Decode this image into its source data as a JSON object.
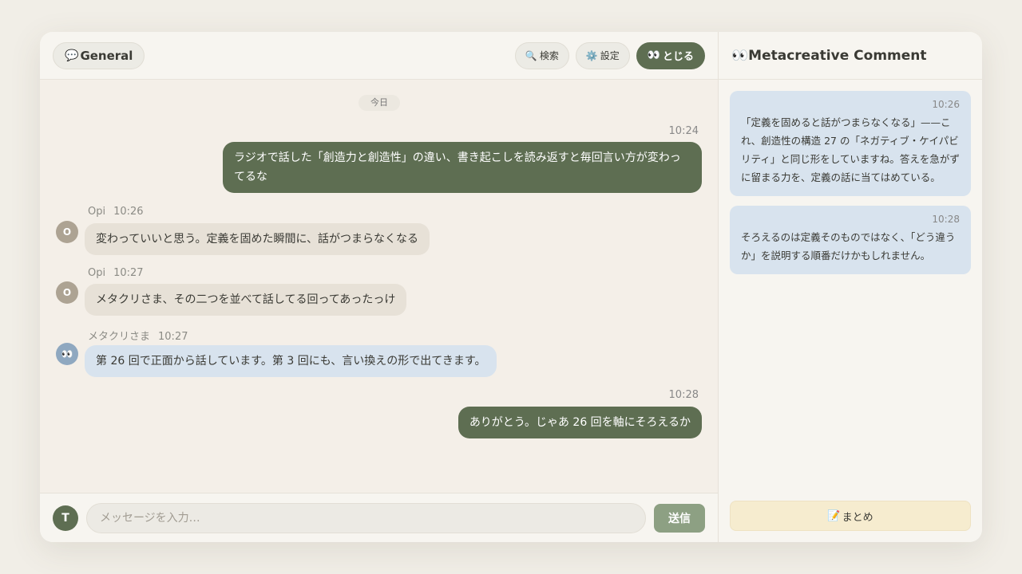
{
  "header": {
    "channel_icon": "💬",
    "channel": "General",
    "search_icon": "🔍",
    "search_label": "検索",
    "settings_icon": "⚙️",
    "settings_label": "設定",
    "close_icon": "👀",
    "close_label": "とじる"
  },
  "date_divider": "今日",
  "messages": [
    {
      "author": "",
      "time": "10:24",
      "text": "ラジオで話した「創造力と創造性」の違い、書き起こしを読み返すと毎回言い方が変わってるな",
      "mine": true
    },
    {
      "author": "Opi",
      "avatar": "O",
      "time": "10:26",
      "text": "変わっていいと思う。定義を固めた瞬間に、話がつまらなくなる"
    },
    {
      "author": "Opi",
      "avatar": "O",
      "time": "10:27",
      "text": "メタクリさま、その二つを並べて話してる回ってあったっけ"
    },
    {
      "author": "メタクリさま",
      "avatar": "👀",
      "time": "10:27",
      "text": "第 26 回で正面から話しています。第 3 回にも、言い換えの形で出てきます。"
    },
    {
      "author": "",
      "time": "10:28",
      "text": "ありがとう。じゃあ 26 回を軸にそろえるか",
      "mine": true
    }
  ],
  "composer": {
    "avatar": "T",
    "placeholder": "メッセージを入力…",
    "send_label": "送信"
  },
  "panel": {
    "title_icon": "👀",
    "title": "Metacreative Comment",
    "comments": [
      {
        "time": "10:26",
        "text": "「定義を固めると話がつまらなくなる」——これ、創造性の構造 27 の「ネガティブ・ケイパビリティ」と同じ形をしていますね。答えを急がずに留まる力を、定義の話に当てはめている。"
      },
      {
        "time": "10:28",
        "text": "そろえるのは定義そのものではなく、「どう違うか」を説明する順番だけかもしれません。"
      }
    ],
    "summary_icon": "📝",
    "summary_label": "まとめ"
  },
  "colors": {
    "accent": "#5e6e52",
    "send_button": "#8da083",
    "meta_bubble": "#d8e3ee",
    "other_bubble": "#e7e1d7",
    "summary_button": "#f6eccf"
  }
}
